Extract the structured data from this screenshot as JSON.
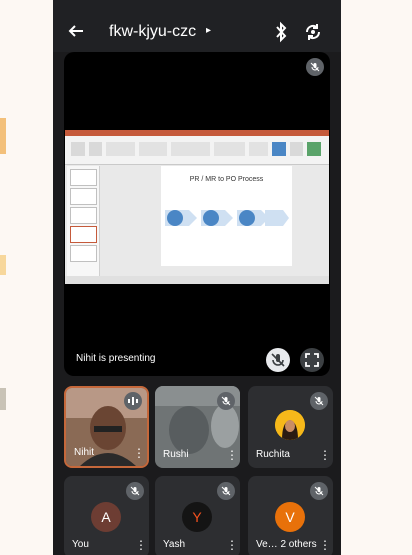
{
  "status_bar": {
    "time": ""
  },
  "top_bar": {
    "meeting_code": "fkw-kjyu-czc",
    "caret": "▸"
  },
  "presentation": {
    "slide_title": "PR / MR to PO Process",
    "presenter_label": "Nihit is presenting"
  },
  "participants": [
    {
      "name": "Nihit",
      "type": "video",
      "speaking": true,
      "muted": false
    },
    {
      "name": "Rushi",
      "type": "video",
      "speaking": false,
      "muted": true
    },
    {
      "name": "Ruchita",
      "type": "photo",
      "speaking": false,
      "muted": true
    },
    {
      "name": "You",
      "type": "avatar",
      "initial": "A",
      "color": "#6d3d33",
      "muted": true
    },
    {
      "name": "Yash",
      "type": "avatar",
      "initial": "Y",
      "color": "#141414",
      "muted": true
    },
    {
      "name": "Ve… 2 others",
      "type": "avatar",
      "initial": "V",
      "color": "#e8710a",
      "muted": true
    }
  ],
  "colors": {
    "background": "#1b1b1d",
    "tile": "#2d2e31",
    "speaking_border": "#c5683b",
    "arrow_blue": "#4a86c5"
  }
}
